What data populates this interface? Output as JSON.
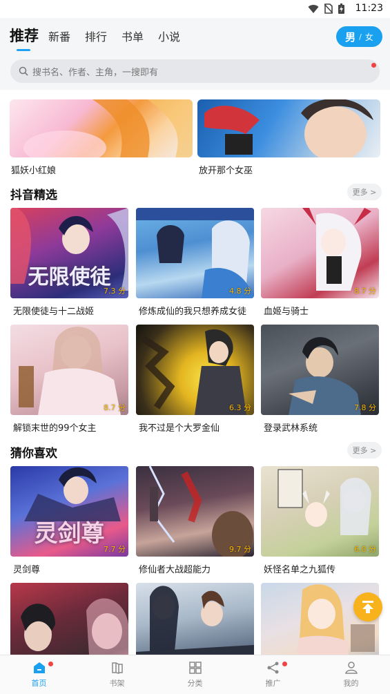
{
  "status": {
    "time": "11:23"
  },
  "header": {
    "tabs": [
      {
        "label": "推荐",
        "active": true
      },
      {
        "label": "新番"
      },
      {
        "label": "排行"
      },
      {
        "label": "书单"
      },
      {
        "label": "小说"
      }
    ],
    "gender": {
      "male": "男",
      "sep": "/",
      "female": "女"
    }
  },
  "search": {
    "placeholder": "搜书名、作者、主角，一搜即有"
  },
  "banners": [
    {
      "title": "狐妖小红娘"
    },
    {
      "title": "放开那个女巫"
    }
  ],
  "sections": [
    {
      "title": "抖音精选",
      "more": "更多 >",
      "items": [
        {
          "title": "无限使徒与十二战姬",
          "score": "7.3 分",
          "cover_text": "无限使徒"
        },
        {
          "title": "修炼成仙的我只想养成女徒",
          "score": "4.8 分"
        },
        {
          "title": "血姬与骑士",
          "score": "8.7 分"
        },
        {
          "title": "解锁末世的99个女主",
          "score": "8.7 分"
        },
        {
          "title": "我不过是个大罗金仙",
          "score": "6.3 分"
        },
        {
          "title": "登录武林系统",
          "score": "7.8 分"
        }
      ]
    },
    {
      "title": "猜你喜欢",
      "more": "更多 >",
      "items": [
        {
          "title": "灵剑尊",
          "score": "7.7 分",
          "cover_text": "灵剑尊"
        },
        {
          "title": "修仙者大战超能力",
          "score": "9.7 分"
        },
        {
          "title": "妖怪名单之九狐传",
          "score": "6.0 分"
        },
        {
          "title": "",
          "score": ""
        },
        {
          "title": "",
          "score": ""
        },
        {
          "title": "",
          "score": ""
        }
      ]
    }
  ],
  "nav": [
    {
      "label": "首页",
      "active": true,
      "badge": true
    },
    {
      "label": "书架"
    },
    {
      "label": "分类"
    },
    {
      "label": "推广",
      "badge": true
    },
    {
      "label": "我的"
    }
  ],
  "colors": {
    "accent": "#19a0ee",
    "score": "#f5b400",
    "badge": "#f04444",
    "fab": "#f7b21c"
  }
}
